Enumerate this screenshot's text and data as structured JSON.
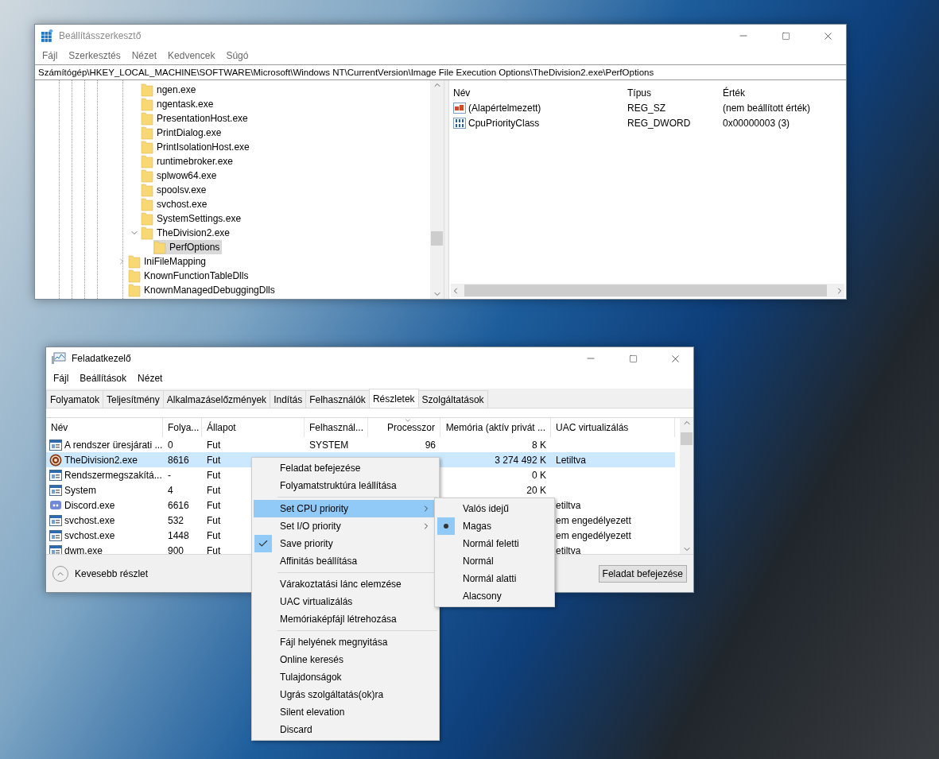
{
  "registry_editor": {
    "title": "Beállításszerkesztő",
    "active": false,
    "menu": [
      "Fájl",
      "Szerkesztés",
      "Nézet",
      "Kedvencek",
      "Súgó"
    ],
    "address": "Számítógép\\HKEY_LOCAL_MACHINE\\SOFTWARE\\Microsoft\\Windows NT\\CurrentVersion\\Image File Execution Options\\TheDivision2.exe\\PerfOptions",
    "tree": [
      {
        "children": [
          {
            "label": "ngen.exe",
            "selected": false
          },
          {
            "label": "ngentask.exe",
            "selected": false
          },
          {
            "label": "PresentationHost.exe",
            "selected": false
          },
          {
            "label": "PrintDialog.exe",
            "selected": false
          },
          {
            "label": "PrintIsolationHost.exe",
            "selected": false
          },
          {
            "label": "runtimebroker.exe",
            "selected": false
          },
          {
            "label": "splwow64.exe",
            "selected": false
          },
          {
            "label": "spoolsv.exe",
            "selected": false
          },
          {
            "label": "svchost.exe",
            "selected": false
          },
          {
            "label": "SystemSettings.exe",
            "selected": false
          },
          {
            "label": "TheDivision2.exe",
            "selected": false,
            "expanded": true,
            "children": [
              {
                "label": "PerfOptions",
                "selected": true
              }
            ]
          }
        ]
      },
      {
        "label": "IniFileMapping",
        "selected": false,
        "expanded": false
      },
      {
        "label": "KnownFunctionTableDlls",
        "selected": false
      },
      {
        "label": "KnownManagedDebuggingDlls",
        "selected": false
      }
    ],
    "columns": [
      "Név",
      "Típus",
      "Érték"
    ],
    "values": [
      {
        "kind": "string",
        "name": "(Alapértelmezett)",
        "type": "REG_SZ",
        "data": "(nem beállított érték)"
      },
      {
        "kind": "binary",
        "name": "CpuPriorityClass",
        "type": "REG_DWORD",
        "data": "0x00000003 (3)"
      }
    ]
  },
  "task_manager": {
    "title": "Feladatkezelő",
    "active": true,
    "menu": [
      "Fájl",
      "Beállítások",
      "Nézet"
    ],
    "tabs": [
      {
        "label": "Folyamatok",
        "selected": false
      },
      {
        "label": "Teljesítmény",
        "selected": false
      },
      {
        "label": "Alkalmazáselőzmények",
        "selected": false
      },
      {
        "label": "Indítás",
        "selected": false
      },
      {
        "label": "Felhasználók",
        "selected": false
      },
      {
        "label": "Részletek",
        "selected": true
      },
      {
        "label": "Szolgáltatások",
        "selected": false
      }
    ],
    "columns": [
      {
        "label": "Név",
        "sorted": false
      },
      {
        "label": "Folya...",
        "sorted": false
      },
      {
        "label": "Állapot",
        "sorted": false
      },
      {
        "label": "Felhasznál...",
        "sorted": false
      },
      {
        "label": "Processzor",
        "sorted": true
      },
      {
        "label": "Memória (aktív privát ...",
        "sorted": false
      },
      {
        "label": "UAC virtualizálás",
        "sorted": false
      }
    ],
    "rows": [
      {
        "kind": "window",
        "name": "A rendszer üresjárati ...",
        "pid": "0",
        "status": "Fut",
        "user": "SYSTEM",
        "cpu": "96",
        "memory": "8 K",
        "selected": false
      },
      {
        "kind": "game",
        "name": "TheDivision2.exe",
        "pid": "8616",
        "status": "Fut",
        "memory": "3 274 492 K",
        "uac": "Letiltva",
        "selected": true
      },
      {
        "kind": "window",
        "name": "Rendszermegszakítá...",
        "pid": "-",
        "status": "Fut",
        "memory": "0 K",
        "selected": false
      },
      {
        "kind": "window",
        "name": "System",
        "pid": "4",
        "status": "Fut",
        "memory": "20 K",
        "selected": false
      },
      {
        "kind": "chat",
        "name": "Discord.exe",
        "pid": "6616",
        "status": "Fut",
        "uac": "etiltva",
        "selected": false
      },
      {
        "kind": "window",
        "name": "svchost.exe",
        "pid": "532",
        "status": "Fut",
        "uac": "em engedélyezett",
        "selected": false
      },
      {
        "kind": "window",
        "name": "svchost.exe",
        "pid": "1448",
        "status": "Fut",
        "uac": "em engedélyezett",
        "selected": false
      },
      {
        "kind": "window",
        "name": "dwm.exe",
        "pid": "900",
        "status": "Fut",
        "uac": "etiltva",
        "selected": false
      }
    ],
    "fewer_details": "Kevesebb részlet",
    "end_task": "Feladat befejezése"
  },
  "context_menu": {
    "items": [
      {
        "kind": "item",
        "label": "Feladat befejezése",
        "selected": false,
        "checked": false
      },
      {
        "kind": "item",
        "label": "Folyamatstruktúra leállítása",
        "selected": false,
        "checked": false
      },
      {
        "kind": "separator"
      },
      {
        "kind": "item",
        "label": "Set CPU priority",
        "selected": true,
        "checked": false,
        "submenu": true
      },
      {
        "kind": "item",
        "label": "Set I/O priority",
        "selected": false,
        "checked": false,
        "submenu": true
      },
      {
        "kind": "item",
        "label": "Save priority",
        "selected": false,
        "checked": true
      },
      {
        "kind": "item",
        "label": "Affinitás beállítása",
        "selected": false,
        "checked": false
      },
      {
        "kind": "separator"
      },
      {
        "kind": "item",
        "label": "Várakoztatási lánc elemzése",
        "selected": false,
        "checked": false
      },
      {
        "kind": "item",
        "label": "UAC virtualizálás",
        "selected": false,
        "checked": false
      },
      {
        "kind": "item",
        "label": "Memóriaképfájl létrehozása",
        "selected": false,
        "checked": false
      },
      {
        "kind": "separator"
      },
      {
        "kind": "item",
        "label": "Fájl helyének megnyitása",
        "selected": false,
        "checked": false
      },
      {
        "kind": "item",
        "label": "Online keresés",
        "selected": false,
        "checked": false
      },
      {
        "kind": "item",
        "label": "Tulajdonságok",
        "selected": false,
        "checked": false
      },
      {
        "kind": "item",
        "label": "Ugrás szolgáltatás(ok)ra",
        "selected": false,
        "checked": false
      },
      {
        "kind": "item",
        "label": "Silent elevation",
        "selected": false,
        "checked": false
      },
      {
        "kind": "item",
        "label": "Discard",
        "selected": false,
        "checked": false
      }
    ],
    "submenu": [
      {
        "label": "Valós idejű",
        "checked": false
      },
      {
        "label": "Magas",
        "checked": true
      },
      {
        "label": "Normál feletti",
        "checked": false
      },
      {
        "label": "Normál",
        "checked": false
      },
      {
        "label": "Normál alatti",
        "checked": false
      },
      {
        "label": "Alacsony",
        "checked": false
      }
    ]
  }
}
